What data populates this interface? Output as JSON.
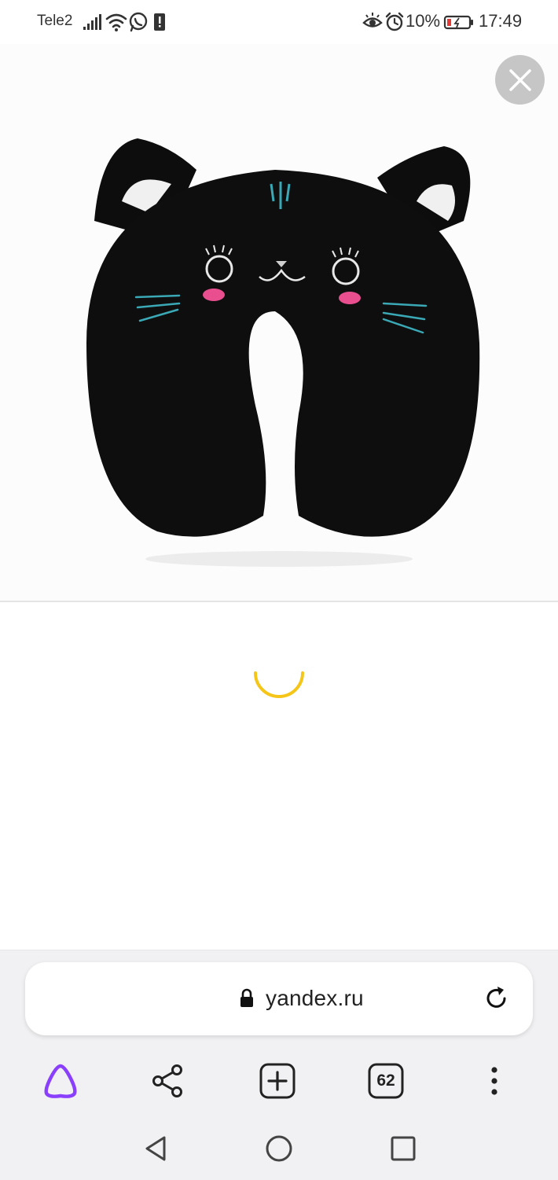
{
  "status_bar": {
    "carrier": "Tele2",
    "battery_percent": "10%",
    "time": "17:49",
    "icons": [
      "signal-icon",
      "wifi-icon",
      "whatsapp-icon",
      "sim-icon",
      "eye-comfort-icon",
      "alarm-icon",
      "battery-low-icon"
    ]
  },
  "viewer": {
    "image_subject": "black cat neck pillow",
    "close_icon": "close-icon"
  },
  "loading": {
    "spinner_color": "#f5c518"
  },
  "address_bar": {
    "url": "yandex.ru",
    "lock_icon": "lock-icon",
    "reload_icon": "reload-icon"
  },
  "toolbar": {
    "alice_icon": "alice-icon",
    "share_icon": "share-icon",
    "new_tab_icon": "plus-icon",
    "tabs_count": "62",
    "menu_icon": "more-vertical-icon",
    "alice_color": "#8a3ffc"
  },
  "system_nav": {
    "back_icon": "back-triangle-icon",
    "home_icon": "home-circle-icon",
    "recents_icon": "recents-square-icon"
  }
}
